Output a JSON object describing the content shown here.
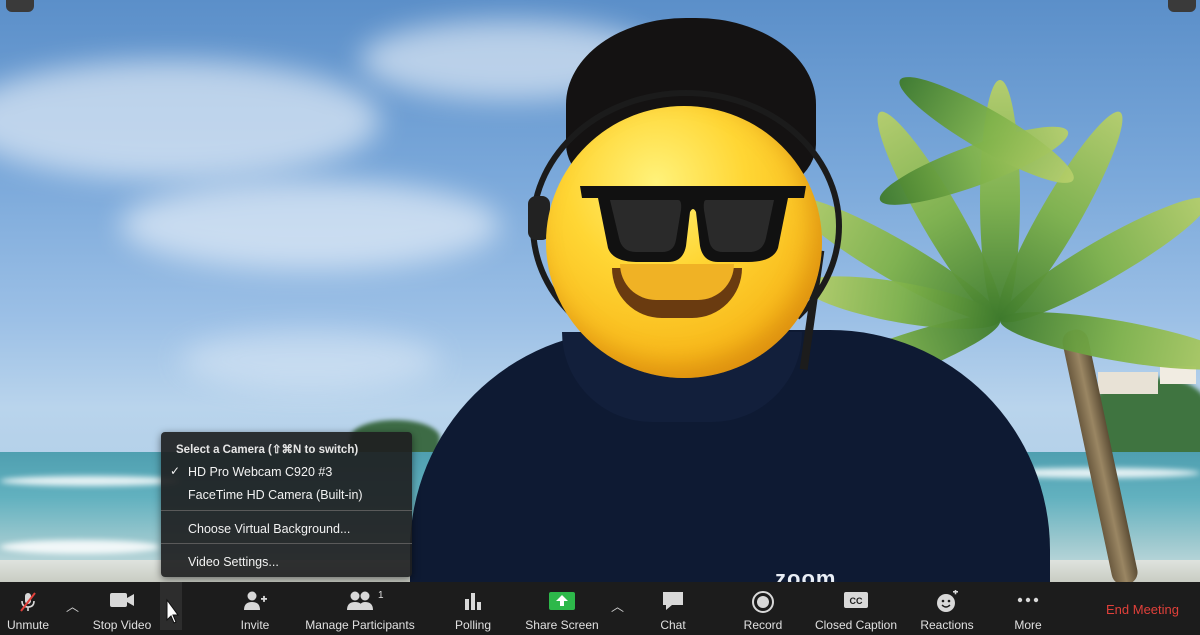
{
  "camera_menu": {
    "header": "Select a Camera (⇧⌘N to switch)",
    "items": [
      {
        "label": "HD Pro Webcam C920 #3",
        "checked": true
      },
      {
        "label": "FaceTime HD Camera (Built-in)",
        "checked": false
      },
      {
        "label": "Choose Virtual Background..."
      },
      {
        "label": "Video Settings..."
      }
    ]
  },
  "video": {
    "shirt_logo": "zoom"
  },
  "toolbar": {
    "unmute": "Unmute",
    "stop_video": "Stop Video",
    "invite": "Invite",
    "manage_participants": "Manage Participants",
    "participant_count": "1",
    "polling": "Polling",
    "share_screen": "Share Screen",
    "chat": "Chat",
    "record": "Record",
    "closed_caption": "Closed Caption",
    "reactions": "Reactions",
    "more": "More",
    "end_meeting": "End Meeting"
  },
  "colors": {
    "toolbar_bg": "#1c1c1c",
    "share_green": "#2db84a",
    "end_red": "#e0403a",
    "mute_slash": "#e0403a"
  }
}
